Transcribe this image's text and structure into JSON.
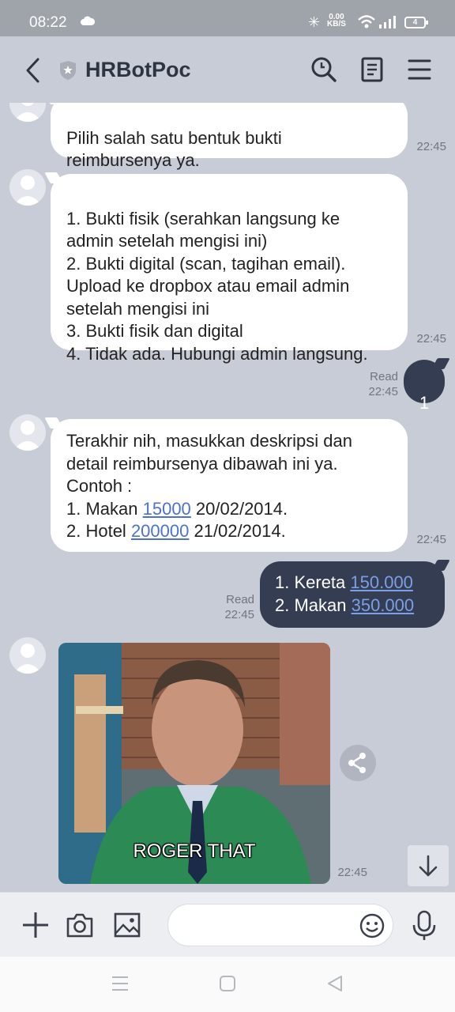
{
  "status_bar": {
    "time": "08:22",
    "net_speed_value": "0.00",
    "net_speed_unit": "KB/S",
    "battery": "4"
  },
  "header": {
    "title": "HRBotPoc",
    "icons": [
      "back-arrow-icon",
      "shield-icon",
      "search-icon",
      "notes-icon",
      "menu-icon"
    ]
  },
  "messages": [
    {
      "side": "in",
      "text": "Pilih salah satu bentuk bukti\nreimbursenya ya.",
      "time": "22:45"
    },
    {
      "side": "in",
      "text": "1. Bukti fisik (serahkan langsung ke\nadmin setelah mengisi ini)\n2. Bukti digital (scan, tagihan email).\nUpload ke dropbox atau email admin\nsetelah mengisi ini\n3. Bukti fisik dan digital\n4. Tidak ada. Hubungi admin langsung.",
      "time": "22:45"
    },
    {
      "side": "out",
      "text": "1",
      "read": "Read",
      "time": "22:45"
    },
    {
      "side": "in",
      "line1": "Terakhir nih, masukkan deskripsi dan",
      "line2": "detail reimbursenya dibawah ini ya.",
      "line3": "Contoh :",
      "line4_pre": "1. Makan ",
      "line4_link": "15000",
      "line4_post": " 20/02/2014.",
      "line5_pre": "2. Hotel ",
      "line5_link": "200000",
      "line5_post": " 21/02/2014.",
      "time": "22:45"
    },
    {
      "side": "out",
      "line1_pre": "1. Kereta ",
      "line1_link": "150.000",
      "line2_pre": "2. Makan ",
      "line2_link": "350.000",
      "read": "Read",
      "time": "22:45"
    },
    {
      "side": "in",
      "type": "gif",
      "caption": "ROGER THAT",
      "time": "22:45"
    }
  ],
  "input_bar": {
    "placeholder": "",
    "icons": [
      "plus-icon",
      "camera-icon",
      "image-icon",
      "emoji-icon",
      "microphone-icon"
    ]
  },
  "nav_bar": {
    "icons": [
      "recents-icon",
      "home-icon",
      "back-icon"
    ]
  },
  "colors": {
    "chat_bg": "#c8ccd6",
    "outgoing_bubble": "#343d52",
    "incoming_bubble": "#ffffff",
    "link": "#4b72cc"
  }
}
